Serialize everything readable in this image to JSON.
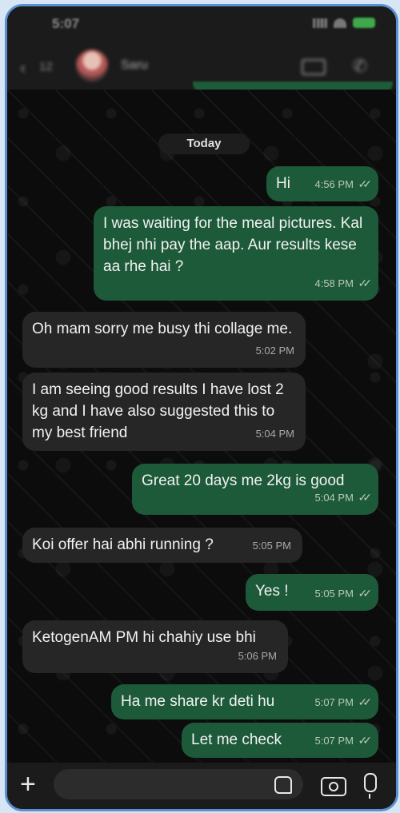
{
  "statusbar": {
    "time": "5:07"
  },
  "header": {
    "back_count": "12",
    "contact_name": "Saru"
  },
  "date_divider": "Today",
  "messages": [
    {
      "dir": "out",
      "text": "Hi",
      "time": "4:56 PM"
    },
    {
      "dir": "out",
      "text": "I was waiting for the meal pictures. Kal bhej nhi pay the aap.  Aur results kese aa rhe hai     ?",
      "time": "4:58 PM"
    },
    {
      "dir": "in",
      "text": "Oh mam sorry me busy thi collage me.",
      "time": "5:02 PM"
    },
    {
      "dir": "in",
      "text": "I am seeing good results I have lost 2 kg and I have also suggested this to my best friend",
      "time": "5:04 PM"
    },
    {
      "dir": "out",
      "text": "Great 20 days me 2kg is good",
      "time": "5:04 PM"
    },
    {
      "dir": "in",
      "text": "Koi offer hai abhi running ?",
      "time": "5:05 PM"
    },
    {
      "dir": "out",
      "text": "Yes !",
      "time": "5:05 PM"
    },
    {
      "dir": "in",
      "text": "KetogenAM PM hi chahiy use bhi",
      "time": "5:06 PM"
    },
    {
      "dir": "out",
      "text": "Ha me share kr deti hu",
      "time": "5:07 PM"
    },
    {
      "dir": "out",
      "text": "Let me check",
      "time": "5:07 PM"
    }
  ],
  "read_receipt": "✓✓",
  "colors": {
    "outgoing": "#1d5a39",
    "incoming": "#262626",
    "frame": "#5b8fd0"
  },
  "icons": {
    "attach": "plus-icon",
    "sticker": "sticker-icon",
    "camera": "camera-icon",
    "mic": "mic-icon"
  },
  "input": {
    "placeholder": ""
  }
}
